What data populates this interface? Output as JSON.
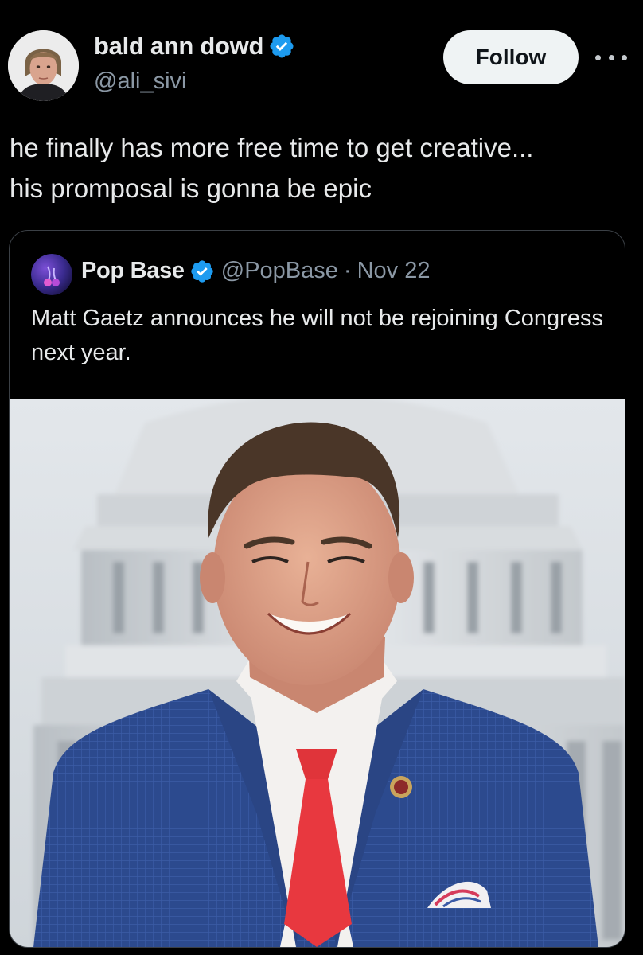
{
  "author": {
    "display_name": "bald ann dowd",
    "handle": "@ali_sivi",
    "verified": true,
    "avatar_icon": "portrait-avatar"
  },
  "actions": {
    "follow_label": "Follow",
    "more_icon": "more-dots-icon"
  },
  "tweet": {
    "text": "he finally has more free time to get creative...\nhis promposal is gonna be epic"
  },
  "quoted": {
    "display_name": "Pop Base",
    "handle": "@PopBase",
    "separator": "·",
    "date": "Nov 22",
    "verified": true,
    "text": "Matt Gaetz announces he will not be rejoining Congress next year.",
    "photo_icon": "man-in-front-of-capitol-photo"
  },
  "colors": {
    "background": "#000000",
    "text": "#e7e9ea",
    "secondary": "#8b98a5",
    "verified": "#1d9bf0",
    "border": "#3b4046"
  }
}
